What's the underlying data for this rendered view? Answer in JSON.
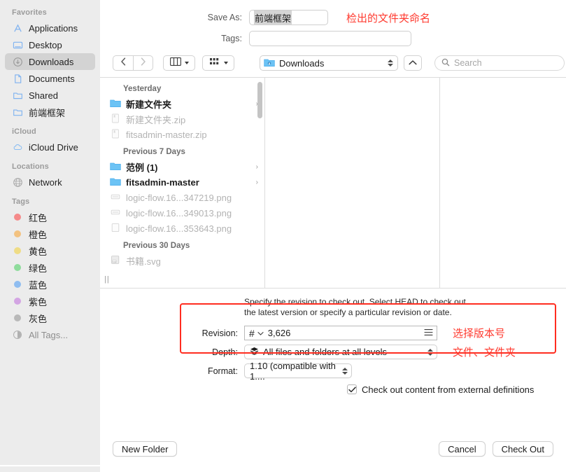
{
  "sidebar": {
    "groups": [
      {
        "header": "Favorites",
        "items": [
          {
            "label": "Applications",
            "icon": "applications-icon",
            "selected": false
          },
          {
            "label": "Desktop",
            "icon": "desktop-icon",
            "selected": false
          },
          {
            "label": "Downloads",
            "icon": "downloads-icon",
            "selected": true
          },
          {
            "label": "Documents",
            "icon": "documents-icon",
            "selected": false
          },
          {
            "label": "Shared",
            "icon": "folder-icon",
            "selected": false
          },
          {
            "label": "前端框架",
            "icon": "folder-icon",
            "selected": false
          }
        ]
      },
      {
        "header": "iCloud",
        "items": [
          {
            "label": "iCloud Drive",
            "icon": "cloud-icon",
            "selected": false
          }
        ]
      },
      {
        "header": "Locations",
        "items": [
          {
            "label": "Network",
            "icon": "globe-icon",
            "selected": false
          }
        ]
      },
      {
        "header": "Tags",
        "items": [
          {
            "label": "红色",
            "icon": "tag-dot-icon",
            "color": "#f58a8a",
            "selected": false
          },
          {
            "label": "橙色",
            "icon": "tag-dot-icon",
            "color": "#f3c280",
            "selected": false
          },
          {
            "label": "黄色",
            "icon": "tag-dot-icon",
            "color": "#efdc86",
            "selected": false
          },
          {
            "label": "绿色",
            "icon": "tag-dot-icon",
            "color": "#8fdc9c",
            "selected": false
          },
          {
            "label": "蓝色",
            "icon": "tag-dot-icon",
            "color": "#8fbdf0",
            "selected": false
          },
          {
            "label": "紫色",
            "icon": "tag-dot-icon",
            "color": "#d3a5e3",
            "selected": false
          },
          {
            "label": "灰色",
            "icon": "tag-dot-icon",
            "color": "#b9b9b9",
            "selected": false
          },
          {
            "label": "All Tags...",
            "icon": "all-tags-icon",
            "color": "",
            "selected": false,
            "muted": true
          }
        ]
      }
    ]
  },
  "save_as": {
    "label": "Save As:",
    "value": "前端框架",
    "placeholder": ""
  },
  "tags": {
    "label": "Tags:",
    "value": "",
    "placeholder": ""
  },
  "annotations": {
    "filename": "检出的文件夹命名",
    "revision": "选择版本号",
    "depth": "文件、文件夹"
  },
  "toolbar": {
    "back_icon": "chevron-left-icon",
    "forward_icon": "chevron-right-icon",
    "view_mode": "column-view-icon",
    "group_by": "group-by-icon",
    "path": {
      "label": "Downloads",
      "icon": "downloads-folder-icon"
    },
    "up_icon": "chevron-up-icon"
  },
  "search": {
    "placeholder": "Search",
    "value": "",
    "icon": "search-icon"
  },
  "file_browser": {
    "groups": [
      {
        "header": "Yesterday",
        "rows": [
          {
            "name": "新建文件夹",
            "icon": "folder-icon",
            "dimmed": false,
            "has_chevron": true
          },
          {
            "name": "新建文件夹.zip",
            "icon": "archive-icon",
            "dimmed": true,
            "has_chevron": false
          },
          {
            "name": "fitsadmin-master.zip",
            "icon": "archive-icon",
            "dimmed": true,
            "has_chevron": false
          }
        ]
      },
      {
        "header": "Previous 7 Days",
        "rows": [
          {
            "name": "范例 (1)",
            "icon": "folder-icon",
            "dimmed": false,
            "has_chevron": true
          },
          {
            "name": "fitsadmin-master",
            "icon": "folder-icon",
            "dimmed": false,
            "has_chevron": true
          },
          {
            "name": "logic-flow.16...347219.png",
            "icon": "image-icon",
            "dimmed": true,
            "has_chevron": false
          },
          {
            "name": "logic-flow.16...349013.png",
            "icon": "image-icon",
            "dimmed": true,
            "has_chevron": false
          },
          {
            "name": "logic-flow.16...353643.png",
            "icon": "image-file-icon",
            "dimmed": true,
            "has_chevron": false
          }
        ]
      },
      {
        "header": "Previous 30 Days",
        "rows": [
          {
            "name": "书籍.svg",
            "icon": "svg-file-icon",
            "dimmed": true,
            "has_chevron": false
          }
        ]
      }
    ],
    "resize_grip": "||"
  },
  "options": {
    "hint_line1": "Specify the revision to check out. Select HEAD to check out",
    "hint_line2": "the latest version or specify a particular revision or date.",
    "revision": {
      "label": "Revision:",
      "token": "#",
      "value": "3,626",
      "list_icon": "list-lines-icon"
    },
    "depth": {
      "label": "Depth:",
      "value": "All files and folders at all levels",
      "icon": "layers-icon"
    },
    "format": {
      "label": "Format:",
      "value": "1.10 (compatible with 1...."
    },
    "externals_checkbox": {
      "label": "Check out content from external definitions",
      "checked": true
    }
  },
  "footer": {
    "new_folder": "New Folder",
    "cancel": "Cancel",
    "check_out": "Check Out"
  }
}
